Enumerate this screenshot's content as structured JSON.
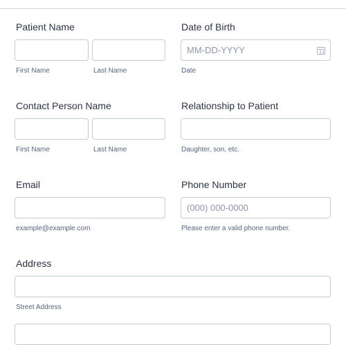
{
  "patient_name": {
    "label": "Patient Name",
    "first_label": "First Name",
    "first_value": "",
    "last_label": "Last Name",
    "last_value": ""
  },
  "date_of_birth": {
    "label": "Date of Birth",
    "placeholder": "MM-DD-YYYY",
    "sublabel": "Date",
    "icon": "calendar-icon"
  },
  "contact_person": {
    "label": "Contact Person Name",
    "first_label": "First Name",
    "first_value": "",
    "last_label": "Last Name",
    "last_value": ""
  },
  "relationship": {
    "label": "Relationship to Patient",
    "value": "",
    "sublabel": "Daughter, son, etc."
  },
  "email": {
    "label": "Email",
    "value": "",
    "sublabel": "example@example.com"
  },
  "phone": {
    "label": "Phone Number",
    "placeholder": "(000) 000-0000",
    "sublabel": "Please enter a valid phone number."
  },
  "address": {
    "label": "Address",
    "street_value": "",
    "street_label": "Street Address"
  },
  "colors": {
    "text": "#2c3345",
    "sublabel": "#57647e",
    "border": "#c3cad8",
    "placeholder": "#8d97ab"
  }
}
